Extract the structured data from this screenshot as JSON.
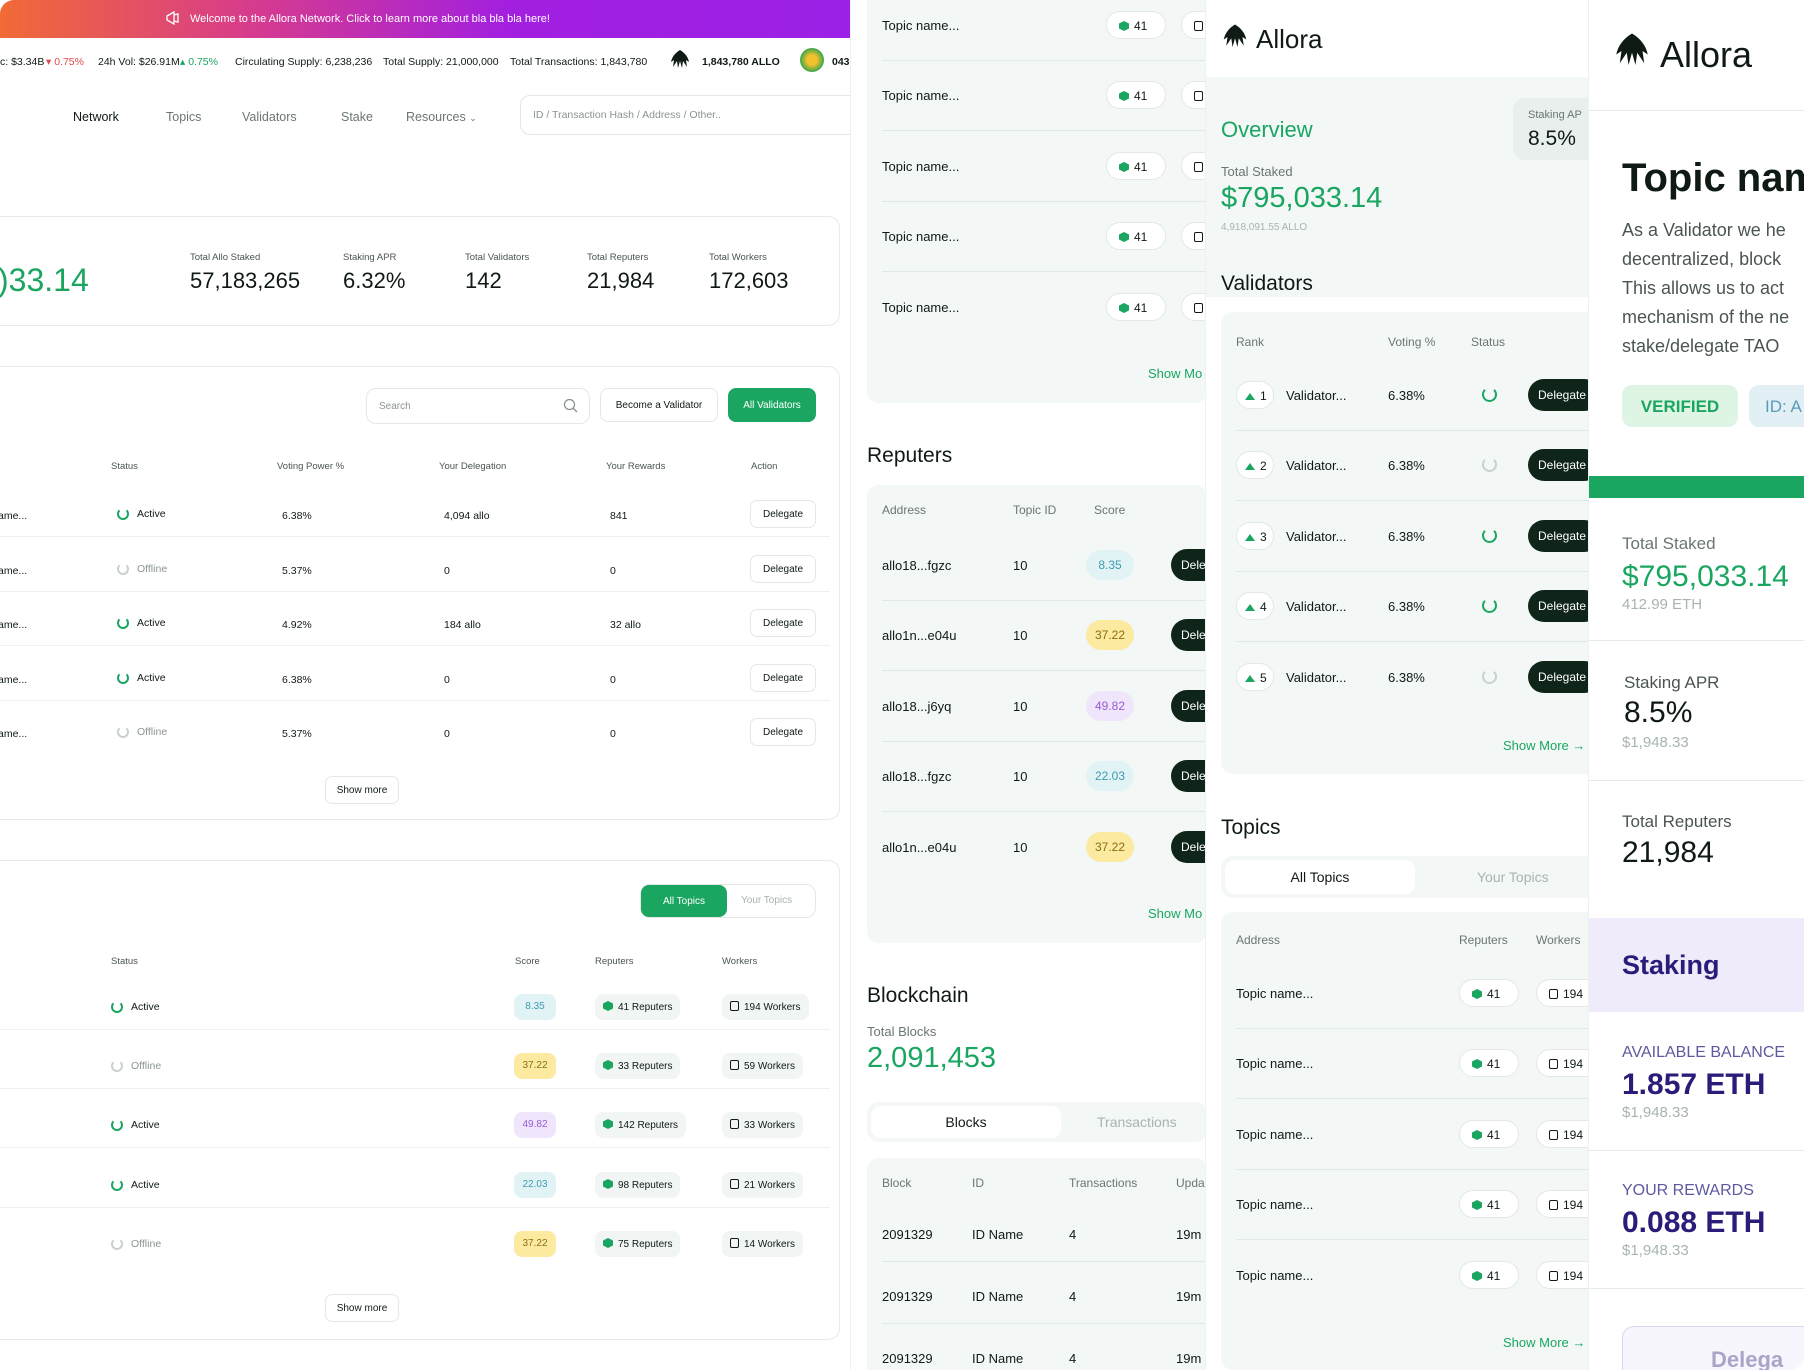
{
  "banner": {
    "text": "Welcome to the Allora Network. Click to learn more about bla bla bla here!",
    "icon": "megaphone-icon"
  },
  "ticker": {
    "market_cap": "c: $3.34B",
    "market_cap_change": "0.75%",
    "vol": "24h Vol: $26.91M",
    "vol_change": "0.75%",
    "circulating": "Circulating Supply: 6,238,236",
    "total_supply": "Total Supply: 21,000,000",
    "total_tx": "Total Transactions: 1,843,780",
    "allo_balance": "1,843,780 ALLO",
    "trail": "043"
  },
  "nav": {
    "items": [
      "Network",
      "Topics",
      "Validators",
      "Stake",
      "Resources"
    ],
    "active": "Network",
    "search_placeholder": "ID / Transaction Hash / Address / Other.."
  },
  "stats": {
    "partial_value": ")33.14",
    "items": [
      {
        "label": "Total Allo Staked",
        "value": "57,183,265"
      },
      {
        "label": "Staking APR",
        "value": "6.32%"
      },
      {
        "label": "Total Validators",
        "value": "142"
      },
      {
        "label": "Total Reputers",
        "value": "21,984"
      },
      {
        "label": "Total Workers",
        "value": "172,603"
      }
    ]
  },
  "validators_table": {
    "search_placeholder": "Search",
    "become_validator": "Become a Validator",
    "all_validators": "All Validators",
    "headers": [
      "Status",
      "Voting Power %",
      "Your Delegation",
      "Your Rewards",
      "Action"
    ],
    "rows": [
      {
        "name": "ame...",
        "status": "Active",
        "voting": "6.38%",
        "delegation": "4,094 allo",
        "rewards": "841",
        "action": "Delegate"
      },
      {
        "name": "ame...",
        "status": "Offline",
        "voting": "5.37%",
        "delegation": "0",
        "rewards": "0",
        "action": "Delegate"
      },
      {
        "name": "ame...",
        "status": "Active",
        "voting": "4.92%",
        "delegation": "184 allo",
        "rewards": "32 allo",
        "action": "Delegate"
      },
      {
        "name": "ame...",
        "status": "Active",
        "voting": "6.38%",
        "delegation": "0",
        "rewards": "0",
        "action": "Delegate"
      },
      {
        "name": "ame...",
        "status": "Offline",
        "voting": "5.37%",
        "delegation": "0",
        "rewards": "0",
        "action": "Delegate"
      }
    ],
    "show_more": "Show more"
  },
  "topics_table": {
    "tab_all": "All Topics",
    "tab_yours": "Your Topics",
    "headers": [
      "Status",
      "Score",
      "Reputers",
      "Workers"
    ],
    "rows": [
      {
        "status": "Active",
        "score": "8.35",
        "score_color": "blue",
        "reputers": "41 Reputers",
        "workers": "194 Workers"
      },
      {
        "status": "Offline",
        "score": "37.22",
        "score_color": "yellow",
        "reputers": "33 Reputers",
        "workers": "59 Workers"
      },
      {
        "status": "Active",
        "score": "49.82",
        "score_color": "purple",
        "reputers": "142 Reputers",
        "workers": "33 Workers"
      },
      {
        "status": "Active",
        "score": "22.03",
        "score_color": "blue",
        "reputers": "98 Reputers",
        "workers": "21 Workers"
      },
      {
        "status": "Offline",
        "score": "37.22",
        "score_color": "yellow",
        "reputers": "75 Reputers",
        "workers": "14 Workers"
      }
    ],
    "show_more": "Show more"
  },
  "p2": {
    "topics": [
      {
        "name": "Topic name...",
        "reputers": "41"
      },
      {
        "name": "Topic name...",
        "reputers": "41"
      },
      {
        "name": "Topic name...",
        "reputers": "41"
      },
      {
        "name": "Topic name...",
        "reputers": "41"
      },
      {
        "name": "Topic name...",
        "reputers": "41"
      }
    ],
    "show_more": "Show Mo",
    "reputers_title": "Reputers",
    "reputers_headers": [
      "Address",
      "Topic ID",
      "Score"
    ],
    "reputers": [
      {
        "address": "allo18...fgzc",
        "topic": "10",
        "score": "8.35",
        "color": "blue",
        "btn": "Dele"
      },
      {
        "address": "allo1n...e04u",
        "topic": "10",
        "score": "37.22",
        "color": "yellow",
        "btn": "Dele"
      },
      {
        "address": "allo18...j6yq",
        "topic": "10",
        "score": "49.82",
        "color": "purple",
        "btn": "Dele"
      },
      {
        "address": "allo18...fgzc",
        "topic": "10",
        "score": "22.03",
        "color": "blue",
        "btn": "Dele"
      },
      {
        "address": "allo1n...e04u",
        "topic": "10",
        "score": "37.22",
        "color": "yellow",
        "btn": "Dele"
      }
    ],
    "reputers_show_more": "Show Mo",
    "blockchain_title": "Blockchain",
    "total_blocks_label": "Total Blocks",
    "total_blocks": "2,091,453",
    "tab_blocks": "Blocks",
    "tab_tx": "Transactions",
    "blocks_headers": [
      "Block",
      "ID",
      "Transactions",
      "Upda"
    ],
    "blocks": [
      {
        "block": "2091329",
        "id": "ID Name",
        "tx": "4",
        "upd": "19m"
      },
      {
        "block": "2091329",
        "id": "ID Name",
        "tx": "4",
        "upd": "19m"
      },
      {
        "block": "2091329",
        "id": "ID Name",
        "tx": "4",
        "upd": "19m"
      }
    ]
  },
  "p3": {
    "logo": "Allora",
    "overview": "Overview",
    "staking_apr_label": "Staking AP",
    "staking_apr": "8.5%",
    "total_staked_label": "Total Staked",
    "total_staked": "$795,033.14",
    "total_staked_sub": "4,918,091.55 ALLO",
    "validators_title": "Validators",
    "validators_headers": [
      "Rank",
      "Voting %",
      "Status"
    ],
    "validators": [
      {
        "rank": "1",
        "name": "Validator...",
        "voting": "6.38%",
        "active": true,
        "btn": "Delegate"
      },
      {
        "rank": "2",
        "name": "Validator...",
        "voting": "6.38%",
        "active": false,
        "btn": "Delegate"
      },
      {
        "rank": "3",
        "name": "Validator...",
        "voting": "6.38%",
        "active": true,
        "btn": "Delegate"
      },
      {
        "rank": "4",
        "name": "Validator...",
        "voting": "6.38%",
        "active": true,
        "btn": "Delegate"
      },
      {
        "rank": "5",
        "name": "Validator...",
        "voting": "6.38%",
        "active": false,
        "btn": "Delegate"
      }
    ],
    "show_more": "Show More",
    "topics_title": "Topics",
    "tab_all": "All Topics",
    "tab_yours": "Your Topics",
    "topics_headers": [
      "Address",
      "Reputers",
      "Workers"
    ],
    "topics": [
      {
        "name": "Topic name...",
        "reputers": "41",
        "workers": "194"
      },
      {
        "name": "Topic name...",
        "reputers": "41",
        "workers": "194"
      },
      {
        "name": "Topic name...",
        "reputers": "41",
        "workers": "194"
      },
      {
        "name": "Topic name...",
        "reputers": "41",
        "workers": "194"
      },
      {
        "name": "Topic name...",
        "reputers": "41",
        "workers": "194"
      }
    ],
    "topics_show_more": "Show More"
  },
  "p4": {
    "logo": "Allora",
    "title": "Topic nam",
    "desc_lines": [
      "As a Validator we he",
      "decentralized, block",
      "This allows us to act",
      "mechanism of the ne",
      "stake/delegate TAO"
    ],
    "verified": "VERIFIED",
    "id_badge": "ID: A",
    "progress": 1.0,
    "total_staked_label": "Total Staked",
    "total_staked": "$795,033.14",
    "total_staked_sub": "412.99 ETH",
    "apr_label": "Staking APR",
    "apr": "8.5%",
    "apr_sub": "$1,948.33",
    "reputers_label": "Total Reputers",
    "reputers": "21,984",
    "staking_title": "Staking",
    "avail_label": "AVAILABLE BALANCE",
    "avail": "1.857 ETH",
    "avail_sub": "$1,948.33",
    "rewards_label": "YOUR REWARDS",
    "rewards": "0.088 ETH",
    "rewards_sub": "$1,948.33",
    "delegate_btn": "Delega"
  },
  "colors": {
    "brand_green": "#1aa661",
    "dark": "#10251a",
    "staking_purple": "#2a1d7a"
  }
}
